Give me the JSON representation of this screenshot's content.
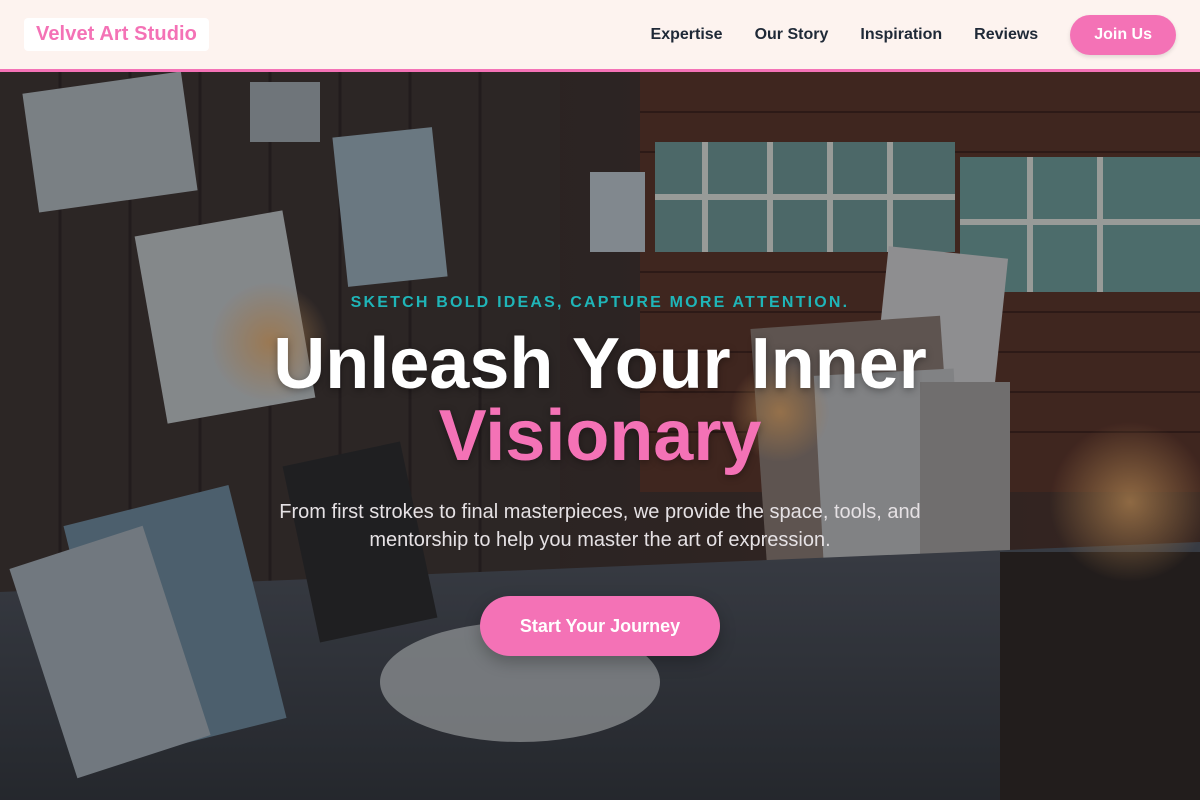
{
  "header": {
    "logo": "Velvet Art Studio",
    "nav": [
      "Expertise",
      "Our Story",
      "Inspiration",
      "Reviews"
    ],
    "cta": "Join Us"
  },
  "hero": {
    "tagline": "SKETCH BOLD IDEAS, CAPTURE MORE ATTENTION.",
    "headline_line1": "Unleash Your Inner",
    "headline_line2": "Visionary",
    "subtext": "From first strokes to final masterpieces, we provide the space, tools, and mentorship to help you master the art of expression.",
    "cta": "Start Your Journey"
  },
  "colors": {
    "accent": "#f472b6",
    "teal": "#1fb5b8",
    "nav_bg": "#fdf3ef"
  },
  "icons": {
    "background_image": "art-studio-photo"
  }
}
